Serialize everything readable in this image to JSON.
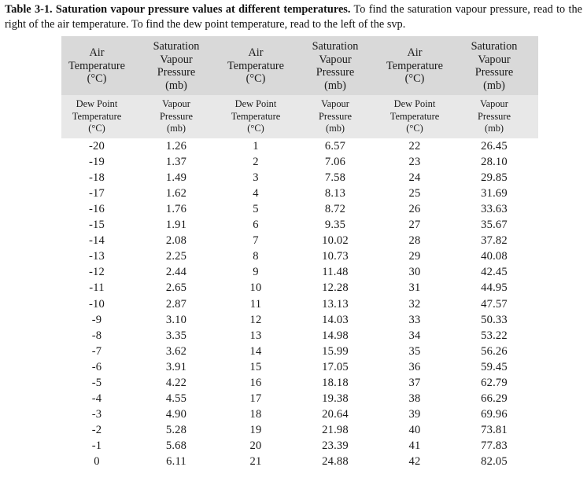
{
  "caption": {
    "lead": "Table 3-1. Saturation vapour pressure values at different temperatures.",
    "body": " To find the saturation vapour pressure, read to the right of the air temperature.  To find the dew point temperature, read to the left of the svp."
  },
  "table": {
    "header_main": [
      "Air\nTemperature\n(°C)",
      "Saturation\nVapour\nPressure\n(mb)",
      "Air\nTemperature\n(°C)",
      "Saturation\nVapour\nPressure\n(mb)",
      "Air\nTemperature\n(°C)",
      "Saturation\nVapour\nPressure\n(mb)"
    ],
    "header_sub": [
      "Dew Point\nTemperature\n(°C)",
      "Vapour\nPressure\n(mb)",
      "Dew Point\nTemperature\n(°C)",
      "Vapour\nPressure\n(mb)",
      "Dew Point\nTemperature\n(°C)",
      "Vapour\nPressure\n(mb)"
    ],
    "rows": [
      [
        "-20",
        "1.26",
        "1",
        "6.57",
        "22",
        "26.45"
      ],
      [
        "-19",
        "1.37",
        "2",
        "7.06",
        "23",
        "28.10"
      ],
      [
        "-18",
        "1.49",
        "3",
        "7.58",
        "24",
        "29.85"
      ],
      [
        "-17",
        "1.62",
        "4",
        "8.13",
        "25",
        "31.69"
      ],
      [
        "-16",
        "1.76",
        "5",
        "8.72",
        "26",
        "33.63"
      ],
      [
        "-15",
        "1.91",
        "6",
        "9.35",
        "27",
        "35.67"
      ],
      [
        "-14",
        "2.08",
        "7",
        "10.02",
        "28",
        "37.82"
      ],
      [
        "-13",
        "2.25",
        "8",
        "10.73",
        "29",
        "40.08"
      ],
      [
        "-12",
        "2.44",
        "9",
        "11.48",
        "30",
        "42.45"
      ],
      [
        "-11",
        "2.65",
        "10",
        "12.28",
        "31",
        "44.95"
      ],
      [
        "-10",
        "2.87",
        "11",
        "13.13",
        "32",
        "47.57"
      ],
      [
        "-9",
        "3.10",
        "12",
        "14.03",
        "33",
        "50.33"
      ],
      [
        "-8",
        "3.35",
        "13",
        "14.98",
        "34",
        "53.22"
      ],
      [
        "-7",
        "3.62",
        "14",
        "15.99",
        "35",
        "56.26"
      ],
      [
        "-6",
        "3.91",
        "15",
        "17.05",
        "36",
        "59.45"
      ],
      [
        "-5",
        "4.22",
        "16",
        "18.18",
        "37",
        "62.79"
      ],
      [
        "-4",
        "4.55",
        "17",
        "19.38",
        "38",
        "66.29"
      ],
      [
        "-3",
        "4.90",
        "18",
        "20.64",
        "39",
        "69.96"
      ],
      [
        "-2",
        "5.28",
        "19",
        "21.98",
        "40",
        "73.81"
      ],
      [
        "-1",
        "5.68",
        "20",
        "23.39",
        "41",
        "77.83"
      ],
      [
        "0",
        "6.11",
        "21",
        "24.88",
        "42",
        "82.05"
      ]
    ]
  },
  "colors": {
    "header_band_main": "#d9d9d9",
    "header_band_sub": "#e8e8e8",
    "page_background": "#ffffff",
    "text": "#1a1a1a"
  }
}
